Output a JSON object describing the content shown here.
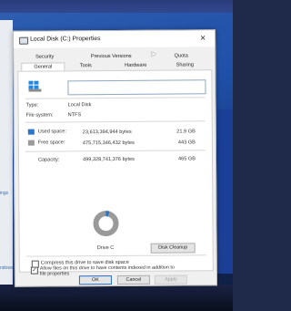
{
  "window": {
    "title": "Local Disk (C:) Properties",
    "close_glyph": "✕"
  },
  "tabs_row1": [
    "Security",
    "Previous Versions",
    "Quota"
  ],
  "tabs_row2": [
    "General",
    "Tools",
    "Hardware",
    "Sharing"
  ],
  "general": {
    "name_value": "",
    "type_label": "Type:",
    "type_value": "Local Disk",
    "fs_label": "File system:",
    "fs_value": "NTFS",
    "used": {
      "label": "Used space:",
      "bytes": "23,613,394,944 bytes",
      "size": "21.9 GB",
      "color": "#2a74c9"
    },
    "free": {
      "label": "Free space:",
      "bytes": "475,715,346,432 bytes",
      "size": "443 GB",
      "color": "#9a9a9a"
    },
    "capacity": {
      "label": "Capacity:",
      "bytes": "499,328,741,376 bytes",
      "size": "465 GB"
    },
    "used_fraction": 0.047,
    "drive_label": "Drive C",
    "disk_cleanup_label": "Disk Cleanup",
    "compress_label": "Compress this drive to save disk space",
    "compress_checked": false,
    "index_label_line1": "Allow files on this drive to have contents indexed in addition to",
    "index_label_line2": "file properties",
    "index_checked": true,
    "check_glyph": "✓"
  },
  "buttons": {
    "ok": "OK",
    "cancel": "Cancel",
    "apply": "Apply"
  },
  "background": {
    "left_text_1": "ings",
    "left_text_2": "ndows"
  }
}
